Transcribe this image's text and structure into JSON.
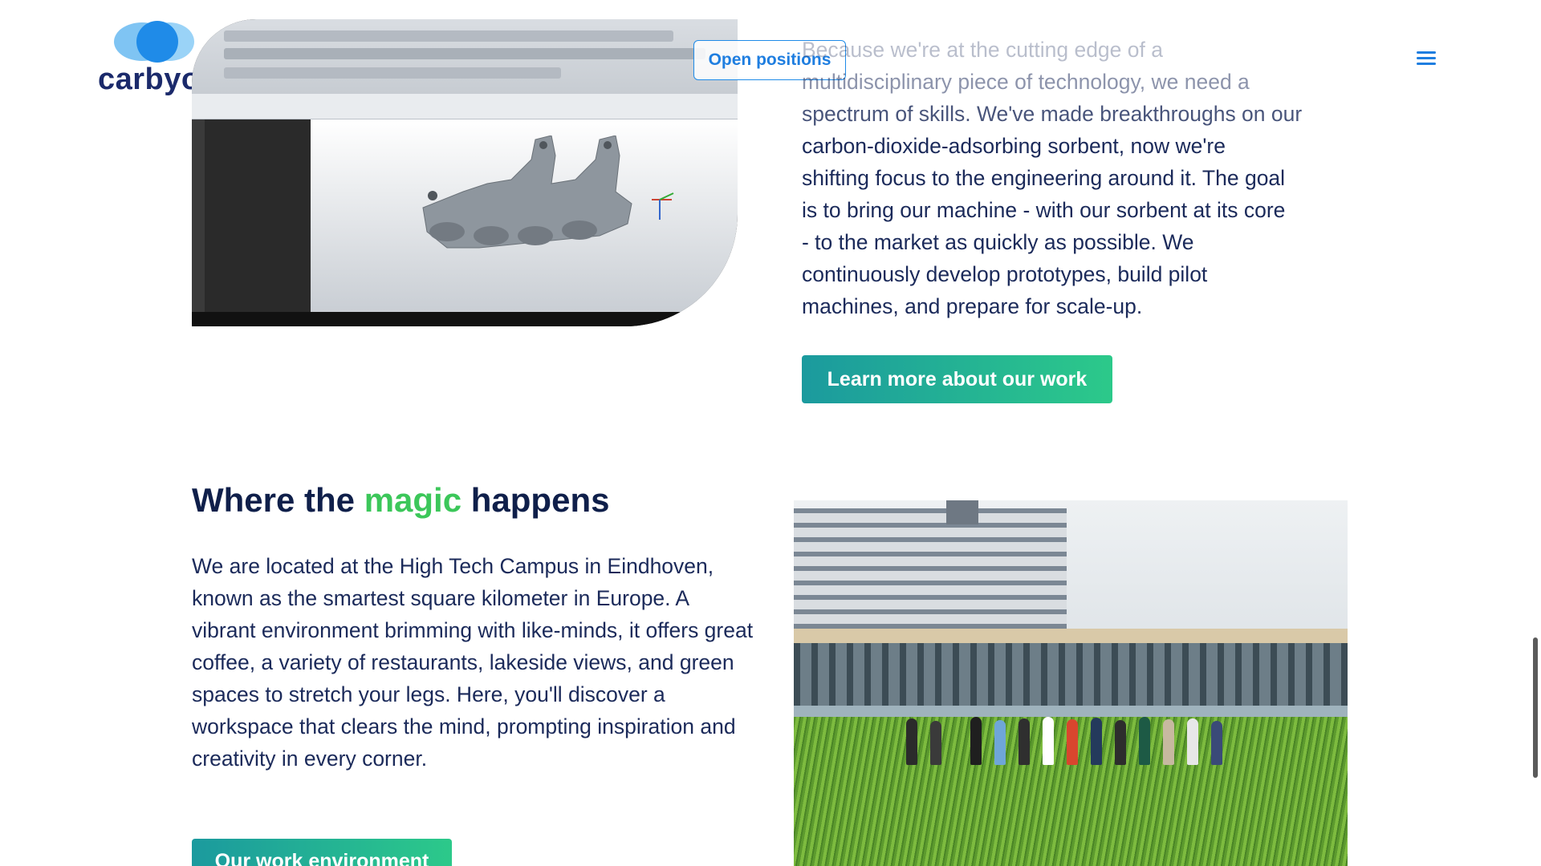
{
  "header": {
    "logo_text": "carbyon",
    "open_positions_label": "Open positions",
    "menu_icon": "hamburger-menu-icon"
  },
  "intro": {
    "lines": [
      "Because we're at the cutting edge of a",
      "multidisciplinary piece of technology, we need a",
      "spectrum of skills. We've made breakthroughs on our",
      "carbon-dioxide-adsorbing sorbent, now we're",
      "shifting focus to the engineering around it. The goal",
      "is to bring our machine - with our sorbent at its core",
      "- to the market as quickly as possible. We",
      "continuously develop prototypes, build pilot",
      "machines, and prepare for scale-up."
    ],
    "button_label": "Learn more about our work"
  },
  "section": {
    "title_before": "Where the ",
    "title_accent": "magic",
    "title_after": " happens",
    "body": "We are located at the High Tech Campus in Eindhoven, known as the smartest square kilometer in Europe. A vibrant environment brimming with like-minds, it offers great coffee, a variety of restaurants, lakeside views, and green spaces to stretch your legs. Here, you'll discover a workspace that clears the mind, prompting inspiration and creativity in every corner.",
    "button_label": "Our work environment"
  },
  "colors": {
    "brand_blue": "#1f8be8",
    "navy": "#0f1f4a",
    "accent_green": "#3cc75a",
    "button_gradient_start": "#1b9a9e",
    "button_gradient_end": "#2cc98a"
  }
}
